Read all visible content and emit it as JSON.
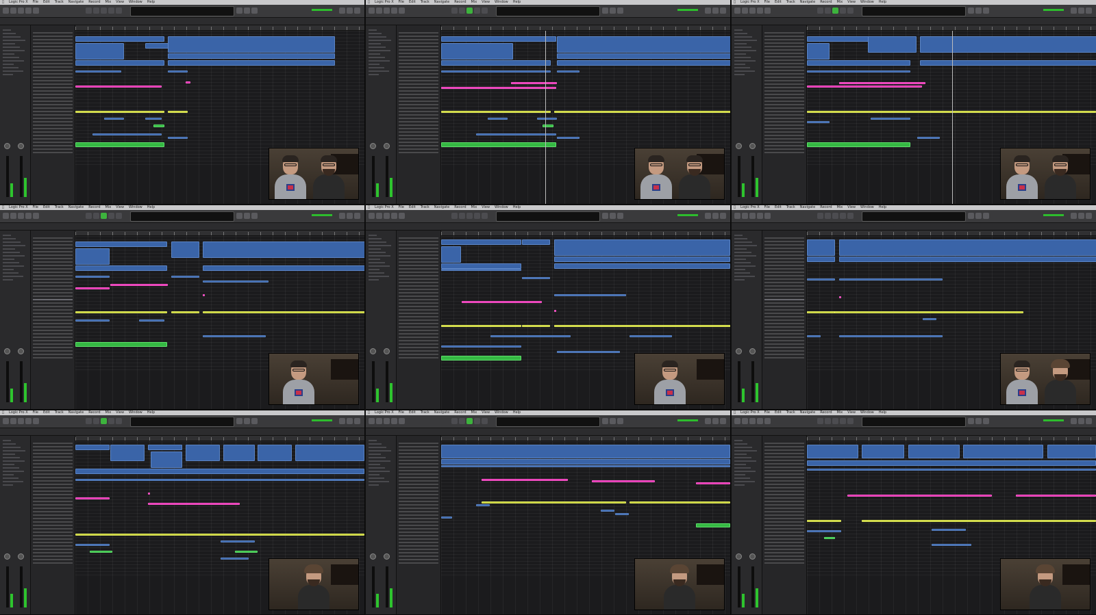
{
  "screen": {
    "description_tag": "logic-pro-tutorial-collage",
    "panel_count": 9
  },
  "colors": {
    "region_blue": "#3a64a8",
    "region_pink": "#d62ba5",
    "region_yellow": "#bec837",
    "region_green": "#35b843",
    "play_active": "#3db33d",
    "lcd_text": "#7fd6ff"
  },
  "panels": [
    {
      "app": "Logic Pro X",
      "menu": [
        "Logic Pro X",
        "File",
        "Edit",
        "Track",
        "Navigate",
        "Record",
        "Mix",
        "View",
        "Window",
        "Help"
      ],
      "lcd": "",
      "playing": false
    },
    {
      "app": "Logic Pro X",
      "menu": [
        "Logic Pro X",
        "File",
        "Edit",
        "Track",
        "Navigate",
        "Record",
        "Mix",
        "View",
        "Window",
        "Help"
      ],
      "lcd": "",
      "playing": true
    },
    {
      "app": "Logic Pro X",
      "menu": [
        "Logic Pro X",
        "File",
        "Edit",
        "Track",
        "Navigate",
        "Record",
        "Mix",
        "View",
        "Window",
        "Help"
      ],
      "lcd": "",
      "playing": true
    },
    {
      "app": "Logic Pro X",
      "menu": [
        "Logic Pro X",
        "File",
        "Edit",
        "Track",
        "Navigate",
        "Record",
        "Mix",
        "View",
        "Window",
        "Help"
      ],
      "lcd": "",
      "playing": true
    },
    {
      "app": "Logic Pro X",
      "menu": [
        "Logic Pro X",
        "File",
        "Edit",
        "Track",
        "Navigate",
        "Record",
        "Mix",
        "View",
        "Window",
        "Help"
      ],
      "lcd": "",
      "playing": false
    },
    {
      "app": "Logic Pro X",
      "menu": [
        "Logic Pro X",
        "File",
        "Edit",
        "Track",
        "Navigate",
        "Record",
        "Mix",
        "View",
        "Window",
        "Help"
      ],
      "lcd": "",
      "playing": false
    },
    {
      "app": "Logic Pro X",
      "menu": [
        "Logic Pro X",
        "File",
        "Edit",
        "Track",
        "Navigate",
        "Record",
        "Mix",
        "View",
        "Window",
        "Help"
      ],
      "lcd": "",
      "playing": true
    },
    {
      "app": "Logic Pro X",
      "menu": [
        "Logic Pro X",
        "File",
        "Edit",
        "Track",
        "Navigate",
        "Record",
        "Mix",
        "View",
        "Window",
        "Help"
      ],
      "lcd": "",
      "playing": true
    },
    {
      "app": "Logic Pro X",
      "menu": [
        "Logic Pro X",
        "File",
        "Edit",
        "Track",
        "Navigate",
        "Record",
        "Mix",
        "View",
        "Window",
        "Help"
      ],
      "lcd": "",
      "playing": false
    }
  ]
}
